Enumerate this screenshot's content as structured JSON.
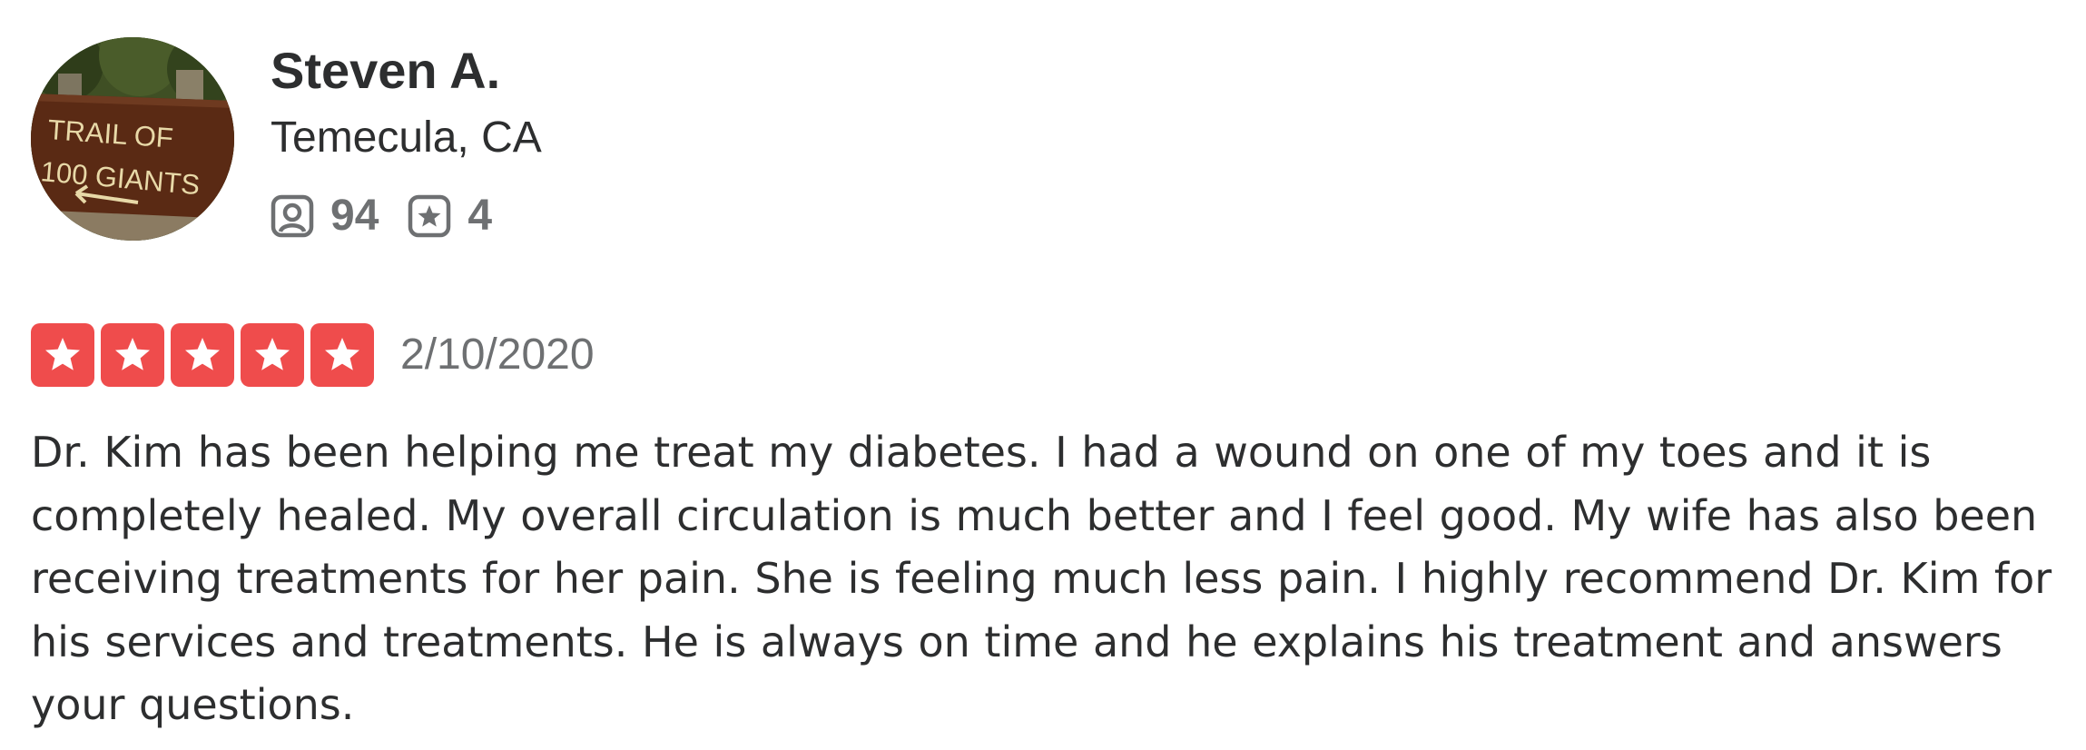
{
  "user": {
    "name": "Steven A.",
    "location": "Temecula, CA",
    "avatar": {
      "sign_line1": "TRAIL OF",
      "sign_line2": "100 GIANTS"
    },
    "stats": {
      "friends_icon": "friends-icon",
      "friends_count": "94",
      "reviews_icon": "star-badge-icon",
      "reviews_count": "4"
    }
  },
  "review": {
    "rating": 5,
    "rating_max": 5,
    "star_color": "#ef4c4c",
    "date": "2/10/2020",
    "text": "Dr. Kim has been helping me treat my diabetes. I had a wound on one of my toes and it is completely healed. My overall circulation is much better and I feel good. My wife has also been receiving treatments for her pain. She is feeling much less pain. I highly recommend Dr. Kim for his services and treatments. He is always on time and he explains his treatment and answers your questions."
  }
}
